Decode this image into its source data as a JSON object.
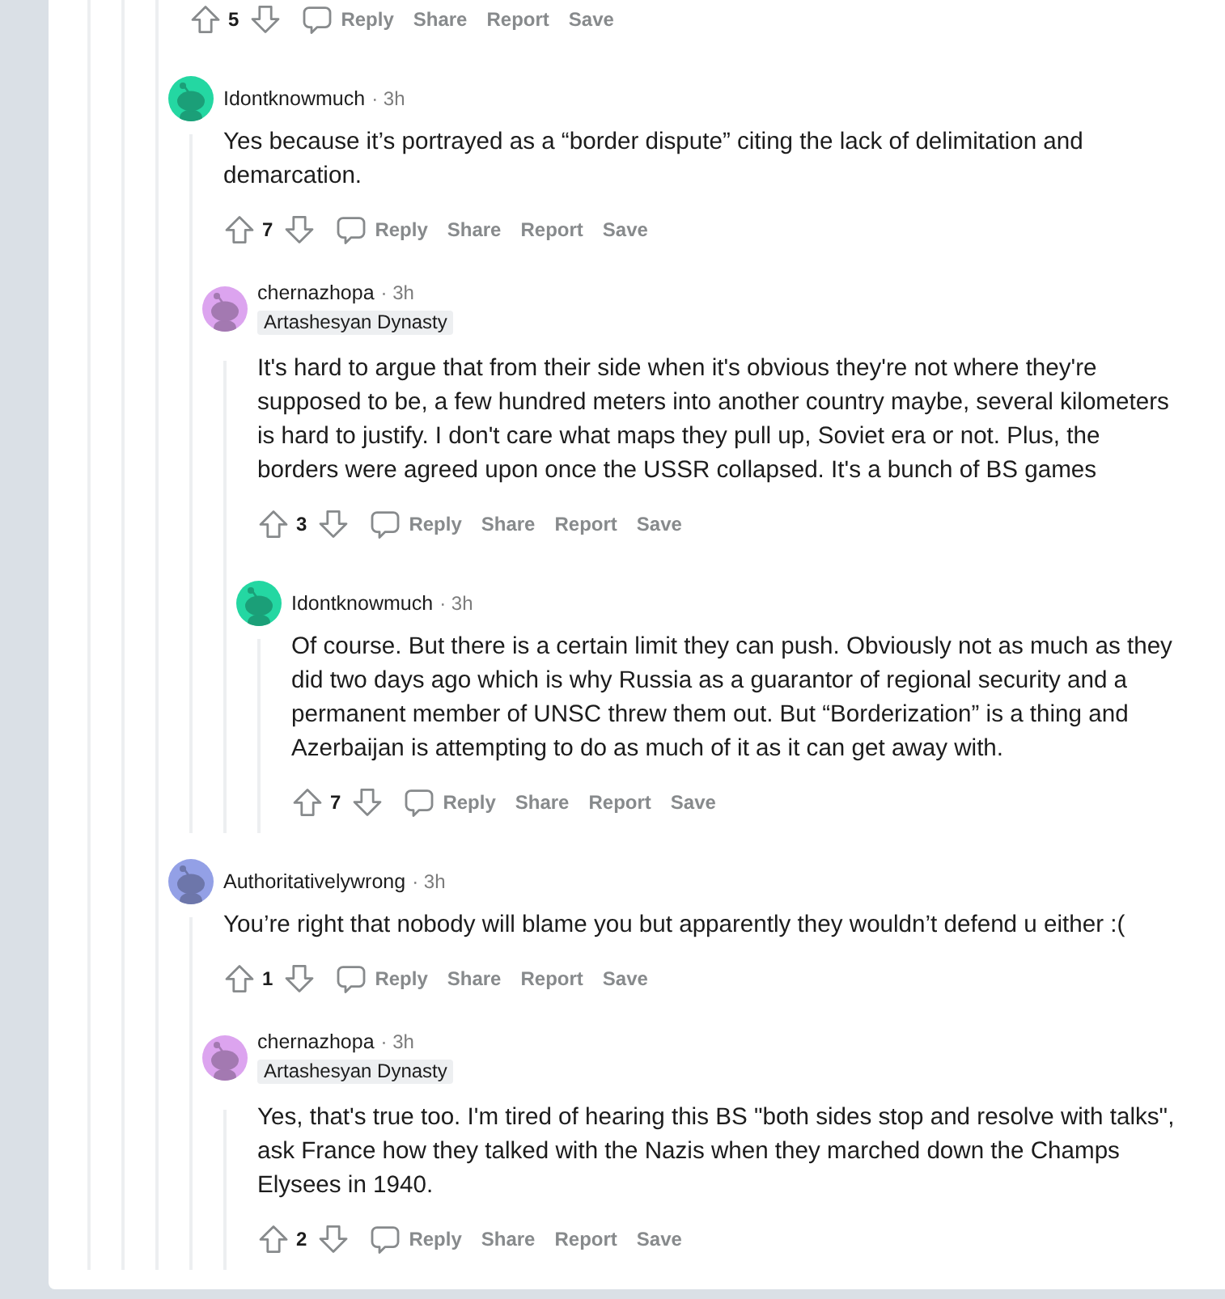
{
  "comments": [
    {
      "votes": "5",
      "actions": [
        {
          "kind": "reply",
          "label": "Reply"
        },
        {
          "kind": "text",
          "label": "Share"
        },
        {
          "kind": "text",
          "label": "Report"
        },
        {
          "kind": "text",
          "label": "Save"
        }
      ],
      "children": [
        {
          "author": "Idontknowmuch",
          "time": "· 3h",
          "color": "#24d7a2",
          "body": "Yes because it’s portrayed as a “border dispute” citing the lack of delimitation and demarcation.",
          "votes": "7",
          "actions": [
            {
              "kind": "reply",
              "label": "Reply"
            },
            {
              "kind": "text",
              "label": "Share"
            },
            {
              "kind": "text",
              "label": "Report"
            },
            {
              "kind": "text",
              "label": "Save"
            }
          ],
          "children": [
            {
              "author": "chernazhopa",
              "time": "· 3h",
              "color": "#dca4ef",
              "flair": "Artashesyan Dynasty",
              "body": "It's hard to argue that from their side when it's obvious they're not where they're supposed to be, a few hundred meters into another country maybe, several kilometers is hard to justify. I don't care what maps they pull up, Soviet era or not. Plus, the borders were agreed upon once the USSR collapsed. It's a bunch of BS games",
              "votes": "3",
              "actions": [
                {
                  "kind": "reply",
                  "label": "Reply"
                },
                {
                  "kind": "text",
                  "label": "Share"
                },
                {
                  "kind": "text",
                  "label": "Report"
                },
                {
                  "kind": "text",
                  "label": "Save"
                }
              ],
              "children": [
                {
                  "author": "Idontknowmuch",
                  "time": "· 3h",
                  "color": "#24d7a2",
                  "body": "Of course. But there is a certain limit they can push. Obviously not as much as they did two days ago which is why Russia as a guarantor of regional security and a permanent member of UNSC threw them out. But “Borderization” is a thing and Azerbaijan is attempting to do as much of it as it can get away with.",
                  "votes": "7",
                  "actions": [
                    {
                      "kind": "reply",
                      "label": "Reply"
                    },
                    {
                      "kind": "text",
                      "label": "Share"
                    },
                    {
                      "kind": "text",
                      "label": "Report"
                    },
                    {
                      "kind": "text",
                      "label": "Save"
                    }
                  ]
                }
              ]
            }
          ]
        },
        {
          "author": "Authoritativelywrong",
          "time": "· 3h",
          "color": "#93a0e6",
          "body": "You’re right that nobody will blame you but apparently they wouldn’t defend u either :(",
          "votes": "1",
          "actions": [
            {
              "kind": "reply",
              "label": "Reply"
            },
            {
              "kind": "text",
              "label": "Share"
            },
            {
              "kind": "text",
              "label": "Report"
            },
            {
              "kind": "text",
              "label": "Save"
            }
          ],
          "children": [
            {
              "author": "chernazhopa",
              "time": "· 3h",
              "color": "#dca4ef",
              "flair": "Artashesyan Dynasty",
              "body": "Yes, that's true too. I'm tired of hearing this BS \"both sides stop and resolve with talks\", ask France how they talked with the Nazis when they marched down the Champs Elysees in 1940.",
              "votes": "2",
              "actions": [
                {
                  "kind": "reply",
                  "label": "Reply"
                },
                {
                  "kind": "text",
                  "label": "Share"
                },
                {
                  "kind": "text",
                  "label": "Report"
                },
                {
                  "kind": "text",
                  "label": "Save"
                }
              ]
            }
          ]
        }
      ]
    }
  ]
}
